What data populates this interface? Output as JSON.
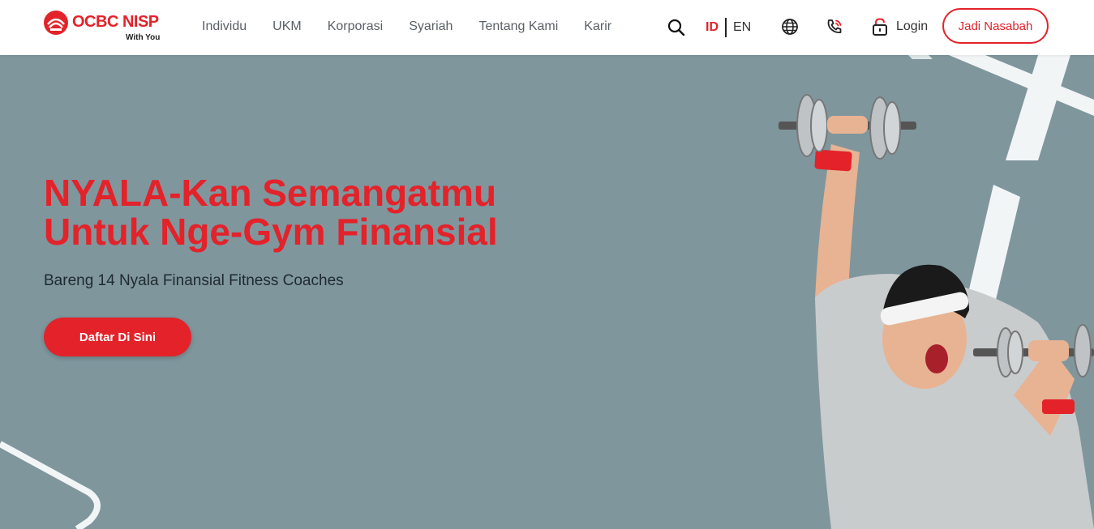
{
  "brand": {
    "name": "OCBC NISP",
    "tagline": "With You",
    "color": "#e3222a"
  },
  "nav": {
    "items": [
      "Individu",
      "UKM",
      "Korporasi",
      "Syariah",
      "Tentang Kami",
      "Karir"
    ]
  },
  "header": {
    "lang_active": "ID",
    "lang_other": "EN",
    "login_label": "Login",
    "cta_label": "Jadi Nasabah",
    "icons": [
      "search-icon",
      "globe-icon",
      "phone-icon",
      "lock-icon"
    ]
  },
  "hero": {
    "title_line1": "NYALA-Kan Semangatmu",
    "title_line2": "Untuk Nge-Gym Finansial",
    "subtitle": "Bareng 14 Nyala Finansial Fitness Coaches",
    "button_label": "Daftar Di Sini",
    "background": "#7f969d"
  }
}
